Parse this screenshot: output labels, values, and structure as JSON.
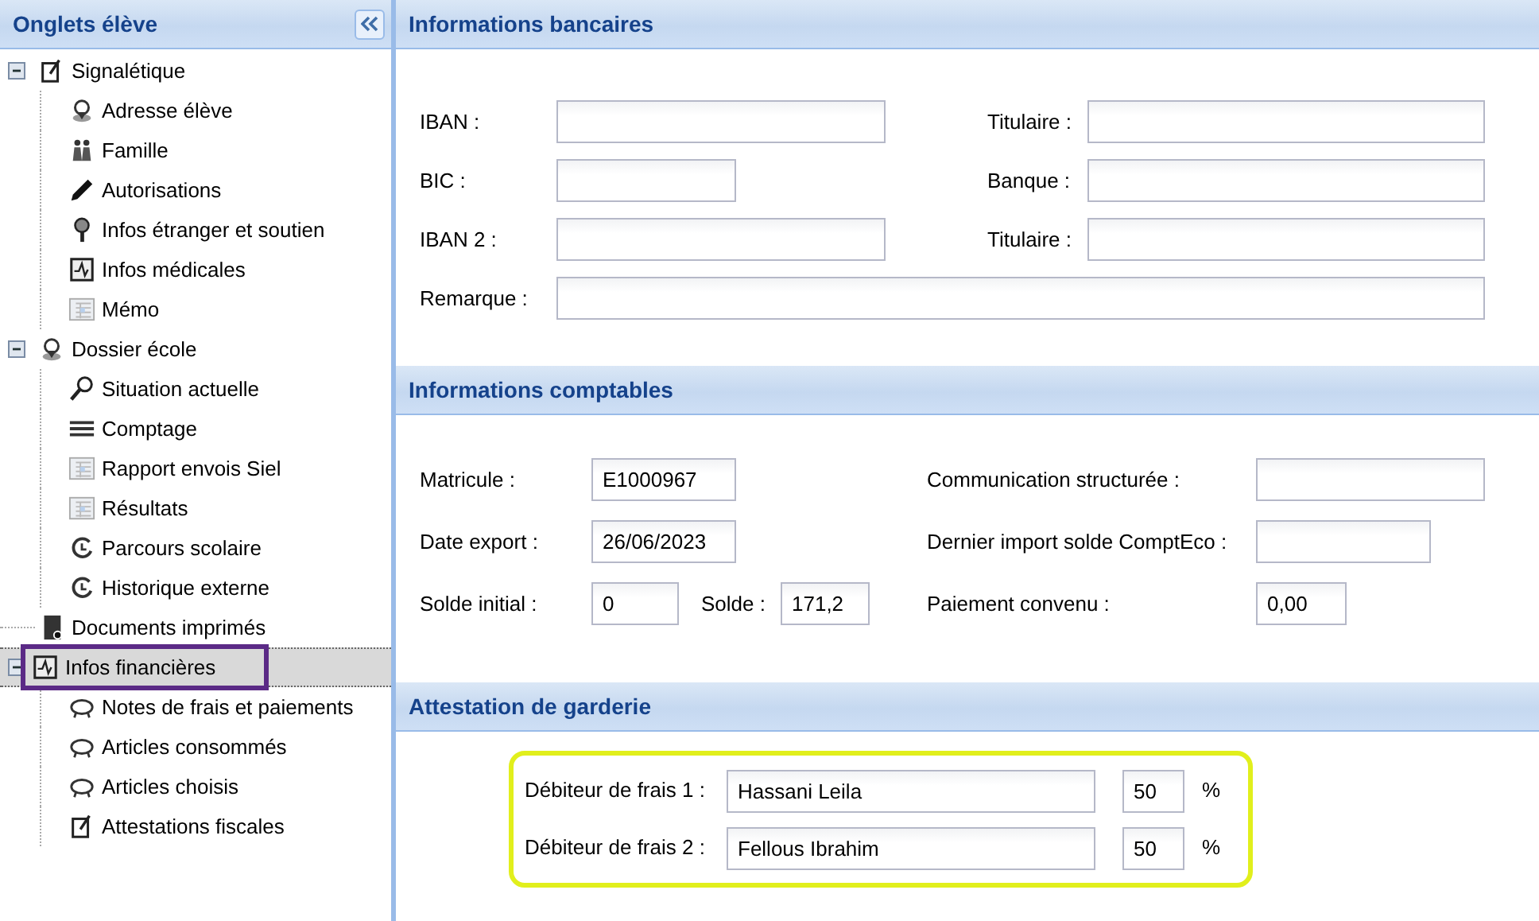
{
  "sidebar": {
    "title": "Onglets élève",
    "items": [
      {
        "label": "Signalétique",
        "kind": "edit",
        "expanded": true,
        "selected": false,
        "children": [
          {
            "label": "Adresse élève",
            "kind": "pin",
            "selected": false
          },
          {
            "label": "Famille",
            "kind": "family",
            "selected": false
          },
          {
            "label": "Autorisations",
            "kind": "pen",
            "selected": false
          },
          {
            "label": "Infos étranger et soutien",
            "kind": "marker",
            "selected": false
          },
          {
            "label": "Infos médicales",
            "kind": "pulse",
            "selected": false
          },
          {
            "label": "Mémo",
            "kind": "table",
            "selected": false
          }
        ]
      },
      {
        "label": "Dossier école",
        "kind": "pin",
        "expanded": true,
        "selected": false,
        "children": [
          {
            "label": "Situation actuelle",
            "kind": "search",
            "selected": false
          },
          {
            "label": "Comptage",
            "kind": "lines",
            "selected": false
          },
          {
            "label": "Rapport envois Siel",
            "kind": "table",
            "selected": false
          },
          {
            "label": "Résultats",
            "kind": "table",
            "selected": false
          },
          {
            "label": "Parcours scolaire",
            "kind": "clock",
            "selected": false
          },
          {
            "label": "Historique externe",
            "kind": "clock",
            "selected": false
          }
        ]
      },
      {
        "label": "Documents imprimés",
        "kind": "document",
        "selected": false
      },
      {
        "label": "Infos financières",
        "kind": "pulse",
        "expanded": true,
        "selected": true,
        "children": [
          {
            "label": "Notes de frais et paiements",
            "kind": "piggy",
            "selected": false
          },
          {
            "label": "Articles consommés",
            "kind": "piggy",
            "selected": false
          },
          {
            "label": "Articles choisis",
            "kind": "piggy",
            "selected": false
          },
          {
            "label": "Attestations fiscales",
            "kind": "edit",
            "selected": false
          }
        ]
      }
    ]
  },
  "sections": [
    {
      "kind": "bank",
      "title": "Informations bancaires",
      "rows": [
        {
          "fields": [
            {
              "label": "IBAN :"
            },
            {
              "label": "Titulaire :"
            }
          ]
        },
        {
          "fields": [
            {
              "label": "BIC :"
            },
            {
              "label": "Banque :"
            }
          ]
        },
        {
          "fields": [
            {
              "label": "IBAN 2 :"
            },
            {
              "label": "Titulaire :"
            }
          ]
        },
        {
          "fields": [
            {
              "label": "Remarque :"
            }
          ]
        }
      ]
    },
    {
      "kind": "accounting",
      "title": "Informations comptables",
      "rows": [
        {
          "fields": [
            {
              "label": "Matricule :",
              "value": "E1000967"
            },
            {
              "label": "Communication structurée :"
            }
          ]
        },
        {
          "fields": [
            {
              "label": "Date export :",
              "value": "26/06/2023"
            },
            {
              "label": "Dernier import solde ComptEco :"
            }
          ]
        },
        {
          "fields": [
            {
              "label": "Solde initial :",
              "value": "0"
            },
            {
              "label": "Solde :",
              "value": "171,2"
            },
            {
              "label": "Paiement convenu :",
              "value": "0,00"
            }
          ]
        }
      ]
    },
    {
      "kind": "daycare",
      "title": "Attestation de garderie",
      "debtors": [
        {
          "label": "Débiteur de frais 1 :",
          "value": "Hassani Leila",
          "share": "50",
          "unit": "%"
        },
        {
          "label": "Débiteur de frais 2 :",
          "value": "Fellous Ibrahim",
          "share": "50",
          "unit": "%"
        }
      ]
    }
  ]
}
